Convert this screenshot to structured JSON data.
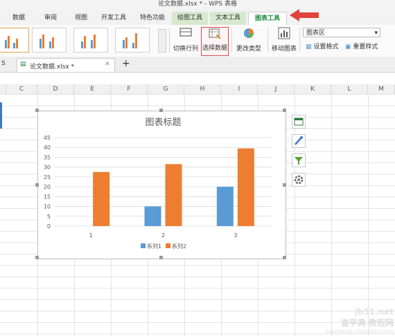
{
  "window": {
    "title": "论文数据.xlsx * - WPS 表格"
  },
  "ribbon_tabs": [
    {
      "label": "数据"
    },
    {
      "label": "审阅"
    },
    {
      "label": "视图"
    },
    {
      "label": "开发工具"
    },
    {
      "label": "特色功能"
    },
    {
      "label": "绘图工具"
    },
    {
      "label": "文本工具"
    },
    {
      "label": "图表工具"
    }
  ],
  "ribbon": {
    "switch_row_col": "切换行列",
    "select_data": "选择数据",
    "change_type": "更改类型",
    "move_chart": "移动图表",
    "chart_area_select": "图表区",
    "set_format": "设置格式",
    "reset_style": "重置样式"
  },
  "doc_tabs": {
    "left_stub": "S",
    "file_tab": "论文数据.xlsx *",
    "add": "+"
  },
  "columns": [
    "C",
    "D",
    "E",
    "F",
    "G",
    "H",
    "I",
    "J",
    "K",
    "L",
    "M"
  ],
  "chart_data": {
    "type": "bar",
    "title": "图表标题",
    "categories": [
      "1",
      "2",
      "3"
    ],
    "series": [
      {
        "name": "系列1",
        "values": [
          0,
          10,
          20
        ],
        "color": "#5b9bd5"
      },
      {
        "name": "系列2",
        "values": [
          27.5,
          31.5,
          39.5
        ],
        "color": "#ed7d31"
      }
    ],
    "ylim": [
      0,
      45
    ],
    "yticks": [
      "0",
      "5",
      "10",
      "15",
      "20",
      "25",
      "30",
      "35",
      "40",
      "45"
    ],
    "grid": true,
    "legend": "bottom"
  },
  "watermark": {
    "line1": "jb51.net",
    "line2": "查字典 教程网",
    "line3": "jiaocheng.chazidian.com"
  },
  "colors": {
    "accent_green": "#1e8a3c",
    "annotation_red": "#e0443b"
  }
}
